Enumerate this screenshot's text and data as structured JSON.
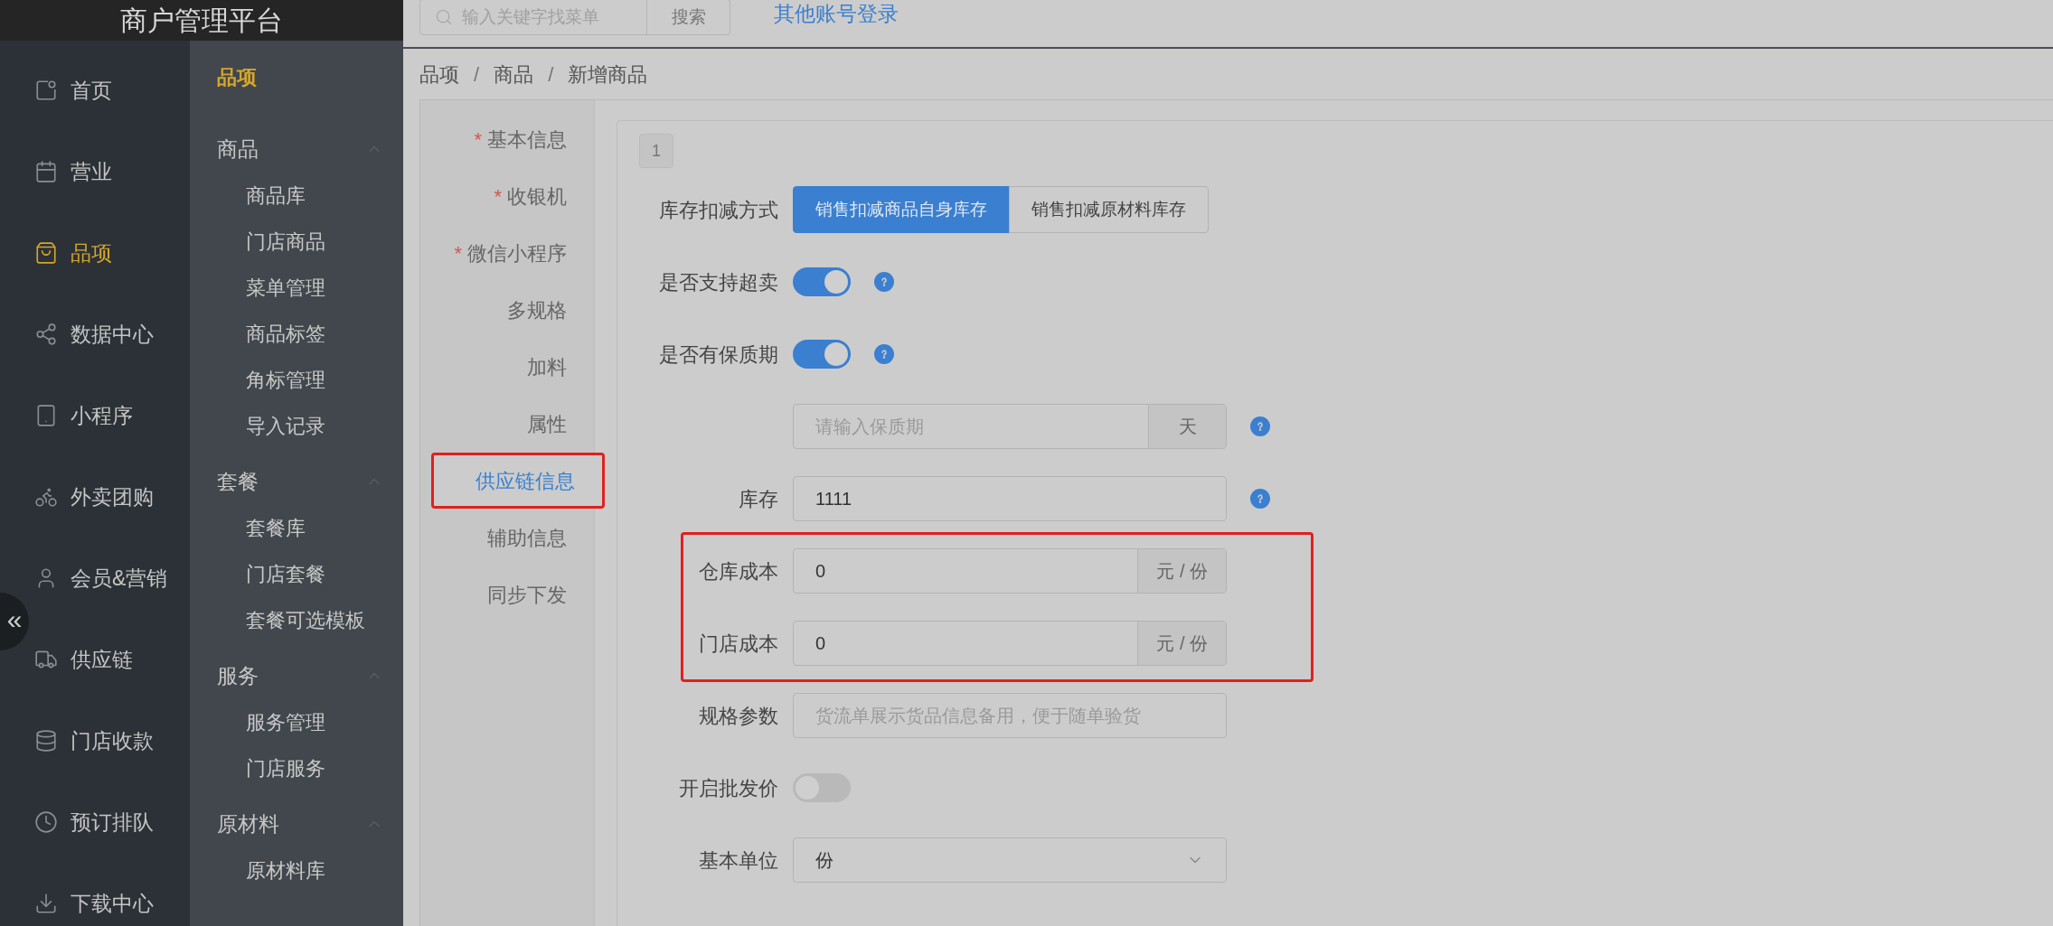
{
  "app_title": "商户管理平台",
  "sidebar": {
    "items": [
      {
        "label": "首页",
        "selected": false
      },
      {
        "label": "营业",
        "selected": false
      },
      {
        "label": "品项",
        "selected": true
      },
      {
        "label": "数据中心",
        "selected": false
      },
      {
        "label": "小程序",
        "selected": false
      },
      {
        "label": "外卖团购",
        "selected": false
      },
      {
        "label": "会员&营销",
        "selected": false
      },
      {
        "label": "供应链",
        "selected": false
      },
      {
        "label": "门店收款",
        "selected": false
      },
      {
        "label": "预订排队",
        "selected": false
      },
      {
        "label": "下载中心",
        "selected": false
      }
    ],
    "collapse_button": "«"
  },
  "submenu": {
    "title": "品项",
    "groups": [
      {
        "label": "商品",
        "expanded": true,
        "children": [
          "商品库",
          "门店商品",
          "菜单管理",
          "商品标签",
          "角标管理",
          "导入记录"
        ]
      },
      {
        "label": "套餐",
        "expanded": true,
        "children": [
          "套餐库",
          "门店套餐",
          "套餐可选模板"
        ]
      },
      {
        "label": "服务",
        "expanded": true,
        "children": [
          "服务管理",
          "门店服务"
        ]
      },
      {
        "label": "原材料",
        "expanded": true,
        "children": [
          "原材料库"
        ]
      }
    ]
  },
  "topbar": {
    "search": {
      "placeholder": "输入关键字找菜单"
    },
    "search_button": "搜索",
    "link": "其他账号登录"
  },
  "breadcrumb": [
    {
      "kind": "link",
      "text": "品项"
    },
    {
      "kind": "separator",
      "text": "/"
    },
    {
      "kind": "link",
      "text": "商品"
    },
    {
      "kind": "separator",
      "text": "/"
    },
    {
      "kind": "current",
      "text": "新增商品"
    }
  ],
  "section_nav": [
    {
      "label": "基本信息",
      "required_mark": "*",
      "selected": false,
      "highlighted": false
    },
    {
      "label": "收银机",
      "required_mark": "*",
      "selected": false,
      "highlighted": false
    },
    {
      "label": "微信小程序",
      "required_mark": "*",
      "selected": false,
      "highlighted": false
    },
    {
      "label": "多规格",
      "selected": false,
      "highlighted": false
    },
    {
      "label": "加料",
      "selected": false,
      "highlighted": false
    },
    {
      "label": "属性",
      "selected": false,
      "highlighted": false
    },
    {
      "label": "供应链信息",
      "selected": true,
      "highlighted": true
    },
    {
      "label": "辅助信息",
      "selected": false,
      "highlighted": false
    },
    {
      "label": "同步下发",
      "selected": false,
      "highlighted": false
    }
  ],
  "form": {
    "badge": "1",
    "rows": [
      {
        "kind": "segmented",
        "label": "库存扣减方式",
        "options": [
          {
            "label": "销售扣减商品自身库存",
            "selected": true
          },
          {
            "label": "销售扣减原材料库存",
            "selected": false
          }
        ]
      },
      {
        "kind": "switch",
        "label": "是否支持超卖",
        "on": true,
        "help": true
      },
      {
        "kind": "switch",
        "label": "是否有保质期",
        "on": true,
        "help": true
      },
      {
        "kind": "input",
        "placeholder": "请输入保质期",
        "suffix": "天",
        "help": true,
        "highlighted": false
      },
      {
        "kind": "input",
        "label": "库存",
        "value": "1111",
        "help": true,
        "highlighted": false
      },
      {
        "kind": "input",
        "label": "仓库成本",
        "value": "0",
        "suffix": "元 / 份",
        "help": false,
        "highlighted": true
      },
      {
        "kind": "input",
        "label": "门店成本",
        "value": "0",
        "suffix": "元 / 份",
        "help": false,
        "highlighted": true
      },
      {
        "kind": "input",
        "label": "规格参数",
        "placeholder": "货流单展示货品信息备用，便于随单验货",
        "help": false,
        "highlighted": false
      },
      {
        "kind": "switch",
        "label": "开启批发价",
        "on": false,
        "help": false
      },
      {
        "kind": "select",
        "label": "基本单位",
        "value": "份"
      }
    ]
  }
}
